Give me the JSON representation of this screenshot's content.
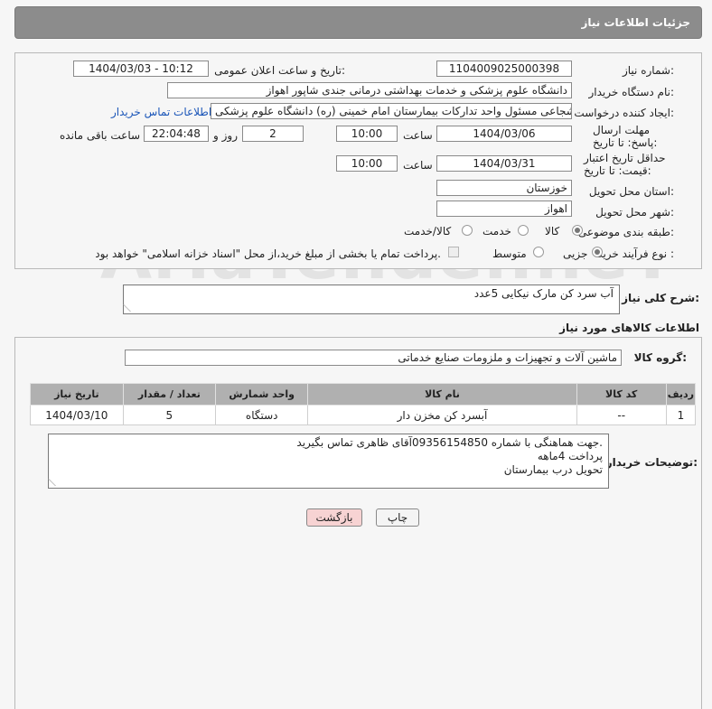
{
  "header": {
    "title": "جزئیات اطلاعات نیاز"
  },
  "form": {
    "need_number": {
      "label": "شماره نیاز:",
      "value": "1104009025000398"
    },
    "announce_datetime": {
      "label": "تاریخ و ساعت اعلان عمومی:",
      "value": "1404/03/03 - 10:12"
    },
    "buyer_org": {
      "label": "نام دستگاه خریدار:",
      "value": "دانشگاه علوم پزشکی و خدمات بهداشتی درمانی جندی شاپور اهواز"
    },
    "requester": {
      "label": "ایجاد کننده درخواست:",
      "value": "سلمان شجاعی مسئول واحد تدارکات بیمارستان امام خمینی (ره) دانشگاه علوم پزشکی",
      "contact_link": "اطلاعات تماس خریدار"
    },
    "reply_deadline": {
      "label": "مهلت ارسال پاسخ: تا تاریخ:",
      "date": "1404/03/06",
      "time_label": "ساعت",
      "time": "10:00",
      "days": "2",
      "days_label": "روز و",
      "remaining": "22:04:48",
      "remaining_label": "ساعت باقی مانده"
    },
    "price_validity": {
      "label": "حداقل تاریخ اعتبار قیمت: تا تاریخ:",
      "date": "1404/03/31",
      "time_label": "ساعت",
      "time": "10:00"
    },
    "delivery_province": {
      "label": "استان محل تحویل:",
      "value": "خوزستان"
    },
    "delivery_city": {
      "label": "شهر محل تحویل:",
      "value": "اهواز"
    },
    "category": {
      "label": "طبقه بندی موضوعی:",
      "options": [
        "کالا",
        "خدمت",
        "کالا/خدمت"
      ],
      "selected": "کالا"
    },
    "purchase_type": {
      "label": "نوع فرآیند خرید :",
      "options": [
        "جزیی",
        "متوسط"
      ],
      "selected": "جزیی",
      "note": "پرداخت تمام یا بخشی از مبلغ خرید،از محل \"اسناد خزانه اسلامی\" خواهد بود."
    }
  },
  "summary": {
    "label": "شرح کلی نیاز:",
    "value": "آب سرد کن مارک نیکایی 5عدد"
  },
  "goods": {
    "section_title": "اطلاعات کالاهای مورد نیاز",
    "group_label": "گروه کالا:",
    "group_value": "ماشین آلات و تجهیزات و ملزومات صنایع خدماتی",
    "columns": [
      "ردیف",
      "کد کالا",
      "نام کالا",
      "واحد شمارش",
      "تعداد / مقدار",
      "تاریخ نیاز"
    ],
    "rows": [
      [
        "1",
        "--",
        "آبسرد کن مخزن دار",
        "دستگاه",
        "5",
        "1404/03/10"
      ]
    ]
  },
  "buyer_notes": {
    "label": "توضیحات خریدار:",
    "lines": [
      "جهت هماهنگی با شماره 09356154850آقای ظاهری تماس بگیرید.",
      "پرداخت 4ماهه",
      "تحویل درب بیمارستان"
    ]
  },
  "actions": {
    "print": "چاپ",
    "back": "بازگشت"
  },
  "colors": {
    "header_bg": "#8c8c8c",
    "table_header_bg": "#b0b0b0",
    "link": "#1a55b8",
    "back_button_bg": "#f7d3d3"
  },
  "watermark": "AriaTender.neT"
}
